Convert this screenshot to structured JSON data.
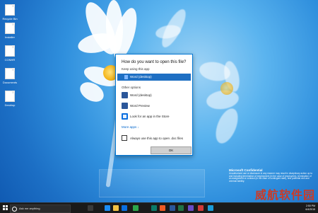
{
  "desktop": {
    "icons": [
      {
        "label": "Recycle Bin"
      },
      {
        "label": "Installer"
      },
      {
        "label": "CONHR"
      },
      {
        "label": "Documents"
      },
      {
        "label": "Desktop"
      }
    ]
  },
  "dialog": {
    "title": "How do you want to open this file?",
    "keep_using_label": "Keep using this app",
    "selected_app": "Word (desktop)",
    "other_options_label": "Other options",
    "apps": [
      {
        "label": "Word (desktop)"
      },
      {
        "label": "Word Preview"
      },
      {
        "label": "Look for an app in the Store"
      }
    ],
    "more_apps": "More apps ↓",
    "always_use_label": "Always use this app to open .doc files",
    "ok_label": "OK"
  },
  "confidential": {
    "heading": "Microsoft Confidential",
    "body": "Unauthorized use or disclosure in any manner may result in disciplinary action up to and including termination of employment (in the case of employees), termination of an assignment or contract (in the case of contingent staff), and potential civil and criminal liability."
  },
  "watermark": {
    "right_text": "威航软件园"
  },
  "taskbar": {
    "search_placeholder": "Ask me anything",
    "time": "2:50 PM",
    "date": "6/4/2015"
  },
  "colors": {
    "accent": "#1e6fc3",
    "taskbar": "#1a1a1a",
    "word": "#2b579a",
    "store": "#0a6fe0"
  }
}
